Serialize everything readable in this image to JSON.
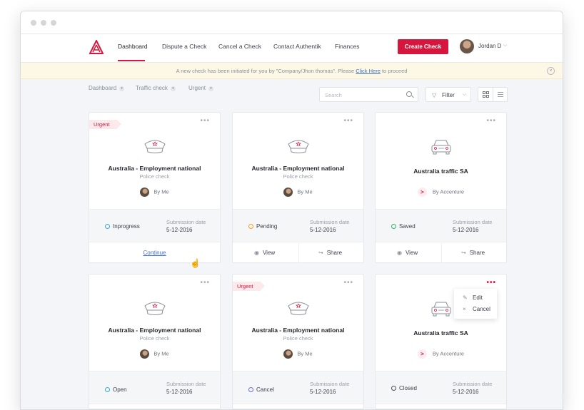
{
  "nav": {
    "items": [
      "Dashboard",
      "Dispute a Check",
      "Cancel a Check",
      "Contact Authentik",
      "Finances"
    ],
    "active": "Dashboard",
    "create_label": "Create Check",
    "user_name": "Jordan D"
  },
  "banner": {
    "text_before": "A new check has been initiated for you by \"Company/Jhon thomas\". Please ",
    "link_text": "Click Here",
    "text_after": " to proceed"
  },
  "breadcrumbs": [
    "Dashboard",
    "Traffic check",
    "Urgent"
  ],
  "search": {
    "placeholder": "Search"
  },
  "filter": {
    "label": "Filter"
  },
  "cards": [
    {
      "urgent": "Urgent",
      "icon": "police-cap-icon",
      "title": "Australia - Employment national",
      "subtitle": "Police check",
      "by": "By Me",
      "status": "Inprogress",
      "status_color": "#3aa6d0",
      "date_label": "Submission date",
      "date": "5-12-2016",
      "action": "Continue"
    },
    {
      "urgent": "",
      "icon": "police-cap-icon",
      "title": "Australia - Employment national",
      "subtitle": "Police check",
      "by": "By Me",
      "status": "Pending",
      "status_color": "#f0a11b",
      "date_label": "Submission date",
      "date": "5-12-2016",
      "view": "View",
      "share": "Share"
    },
    {
      "urgent": "",
      "icon": "car-icon",
      "title": "Australia traffic SA",
      "subtitle": "",
      "by": "By Accenture",
      "status": "Saved",
      "status_color": "#2fb36b",
      "date_label": "Submission date",
      "date": "5-12-2016",
      "view": "View",
      "share": "Share"
    },
    {
      "urgent": "",
      "icon": "police-cap-icon",
      "title": "Australia - Employment national",
      "subtitle": "Police check",
      "by": "By Me",
      "status": "Open",
      "status_color": "#3aa6d0",
      "date_label": "Submission date",
      "date": "5-12-2016"
    },
    {
      "urgent": "Urgent",
      "icon": "police-cap-icon",
      "title": "Australia - Employment national",
      "subtitle": "Police check",
      "by": "By Me",
      "status": "Cancel",
      "status_color": "#6b6fd6",
      "date_label": "Submission date",
      "date": "5-12-2016"
    },
    {
      "urgent": "",
      "icon": "car-icon",
      "title": "Australia traffic SA",
      "subtitle": "",
      "by": "By Accenture",
      "status": "Closed",
      "status_color": "#4a4f59",
      "date_label": "Submission date",
      "date": "5-12-2016"
    }
  ],
  "context_menu": {
    "edit": "Edit",
    "cancel": "Cancel"
  },
  "colors": {
    "accent": "#d6163c",
    "link": "#3e6fc9"
  }
}
